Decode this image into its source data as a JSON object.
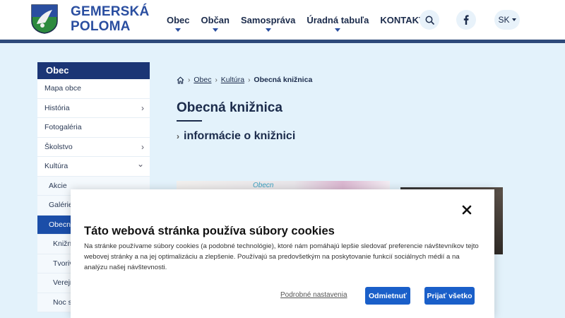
{
  "header": {
    "logo_line1": "GEMERSKÁ",
    "logo_line2": "POLOMA",
    "nav": [
      {
        "label": "Obec",
        "dropdown": true
      },
      {
        "label": "Občan",
        "dropdown": true
      },
      {
        "label": "Samospráva",
        "dropdown": true
      },
      {
        "label": "Úradná tabuľa",
        "dropdown": true
      },
      {
        "label": "KONTAKTY",
        "dropdown": false
      }
    ],
    "search_icon": "search-icon",
    "facebook_icon": "facebook-icon",
    "language": "SK"
  },
  "sidebar": {
    "title": "Obec",
    "items": [
      {
        "label": "Mapa obce",
        "level": 0,
        "chevron": ""
      },
      {
        "label": "História",
        "level": 0,
        "chevron": "›"
      },
      {
        "label": "Fotogaléria",
        "level": 0,
        "chevron": ""
      },
      {
        "label": "Školstvo",
        "level": 0,
        "chevron": "›"
      },
      {
        "label": "Kultúra",
        "level": 0,
        "chevron": "⌄"
      },
      {
        "label": "Akcie",
        "level": 1,
        "chevron": ""
      },
      {
        "label": "Galérie",
        "level": 1,
        "chevron": ""
      },
      {
        "label": "Obecná knižnica",
        "level": 1,
        "chevron": "",
        "active": true
      },
      {
        "label": "Knižnica",
        "level": 2,
        "chevron": ""
      },
      {
        "label": "Tvorivé dielne",
        "level": 2,
        "chevron": ""
      },
      {
        "label": "Verejné čítanie",
        "level": 2,
        "chevron": ""
      },
      {
        "label": "Noc s Andersenom",
        "level": 2,
        "chevron": ""
      }
    ]
  },
  "breadcrumb": {
    "home_icon": "home-icon",
    "items": [
      "Obec",
      "Kultúra"
    ],
    "current": "Obecná knižnica"
  },
  "main": {
    "title": "Obecná knižnica",
    "sub_link": "informácie o knižnici",
    "photo_caption": "Obecn"
  },
  "cookie": {
    "title": "Táto webová stránka používa súbory cookies",
    "text": "Na stránke používame súbory cookies (a podobné technológie), ktoré nám pomáhajú lepšie sledovať preferencie návštevníkov tejto webovej stránky a na jej optimalizáciu a zlepšenie. Používajú sa predovšetkým na poskytovanie funkcií sociálnych médií a na analýzu našej návštevnosti.",
    "settings_link": "Podrobné nastavenia",
    "reject_label": "Odmietnuť",
    "accept_label": "Prijať všetko",
    "close_icon": "close-icon"
  },
  "colors": {
    "brand_blue": "#2a4ea0",
    "sidebar_header": "#1b3575",
    "active_item": "#1b4ea8",
    "button_blue": "#1a5fc9",
    "page_bg": "#e3f2fb"
  }
}
